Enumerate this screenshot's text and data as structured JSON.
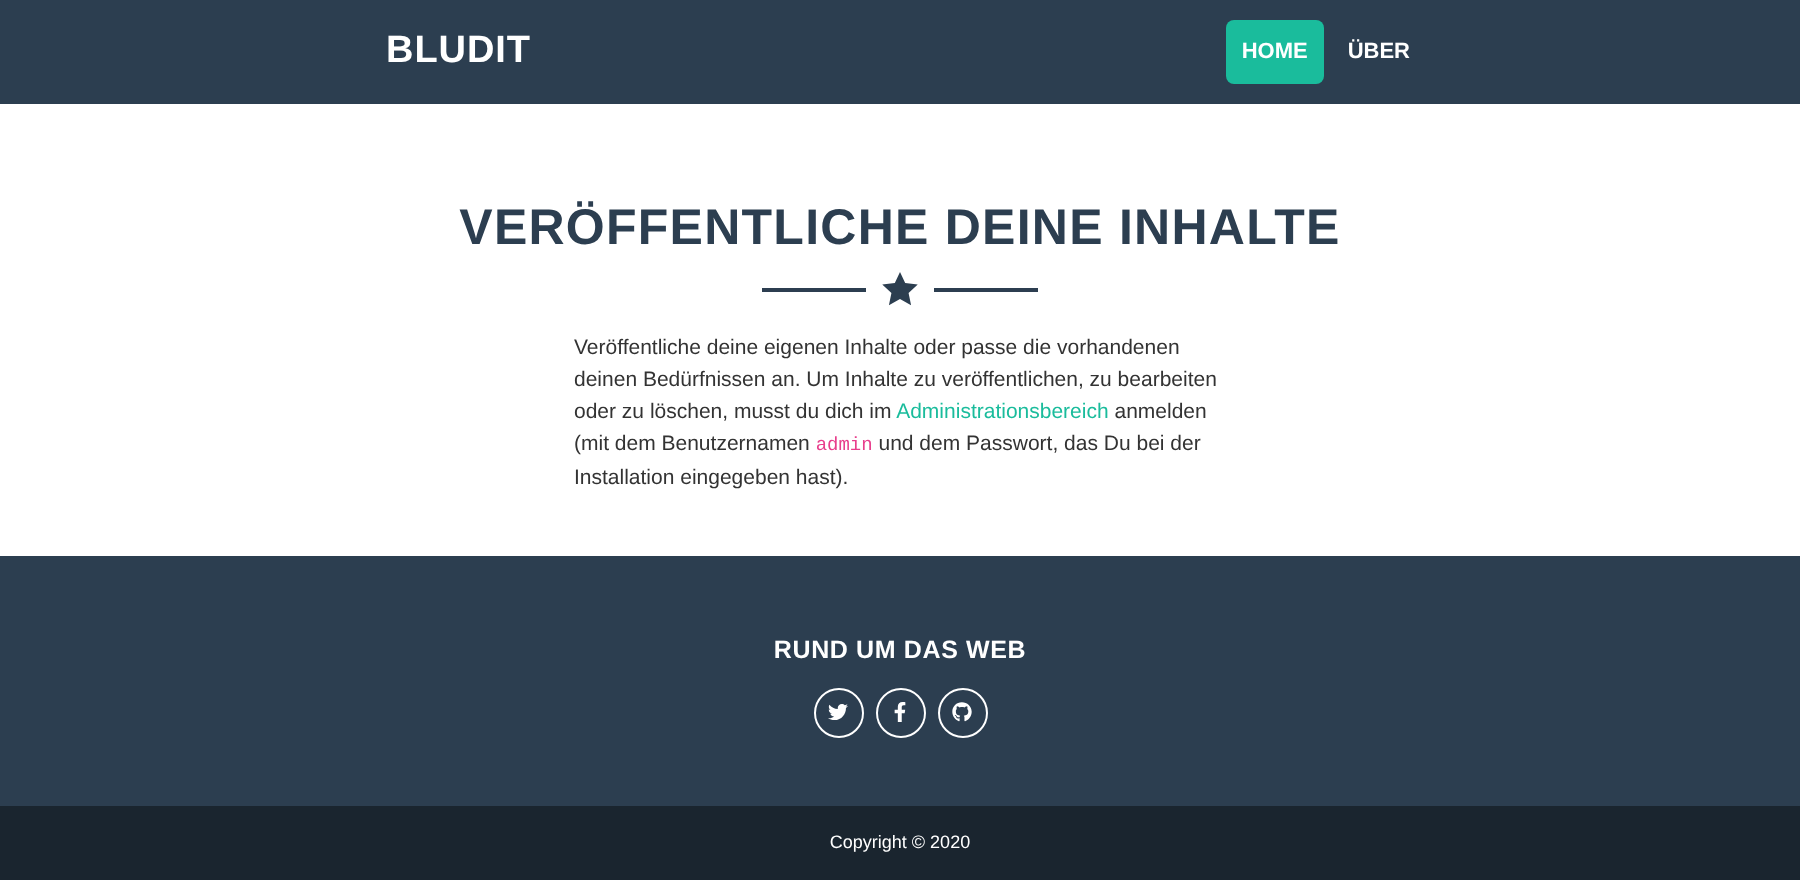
{
  "navbar": {
    "brand": "BLUDIT",
    "links": [
      {
        "label": "HOME",
        "selected": true
      },
      {
        "label": "ÜBER",
        "selected": false
      }
    ]
  },
  "main": {
    "title": "VERÖFFENTLICHE DEINE INHALTE",
    "paragraph": [
      {
        "kind": "text",
        "text": "Veröffentliche deine eigenen Inhalte oder passe die vorhandenen deinen Bedürfnissen an. Um Inhalte zu veröffentlichen, zu bearbeiten oder zu löschen, musst du dich im "
      },
      {
        "kind": "link",
        "text": "Administrationsbereich"
      },
      {
        "kind": "text",
        "text": " anmelden (mit dem Benutzernamen "
      },
      {
        "kind": "code",
        "text": "admin"
      },
      {
        "kind": "text",
        "text": " und dem Passwort, das Du bei der Installation eingegeben hast)."
      }
    ]
  },
  "footer": {
    "heading": "RUND UM DAS WEB",
    "social": [
      {
        "kind": "twitter"
      },
      {
        "kind": "facebook"
      },
      {
        "kind": "github"
      }
    ]
  },
  "copyright": "Copyright © 2020"
}
